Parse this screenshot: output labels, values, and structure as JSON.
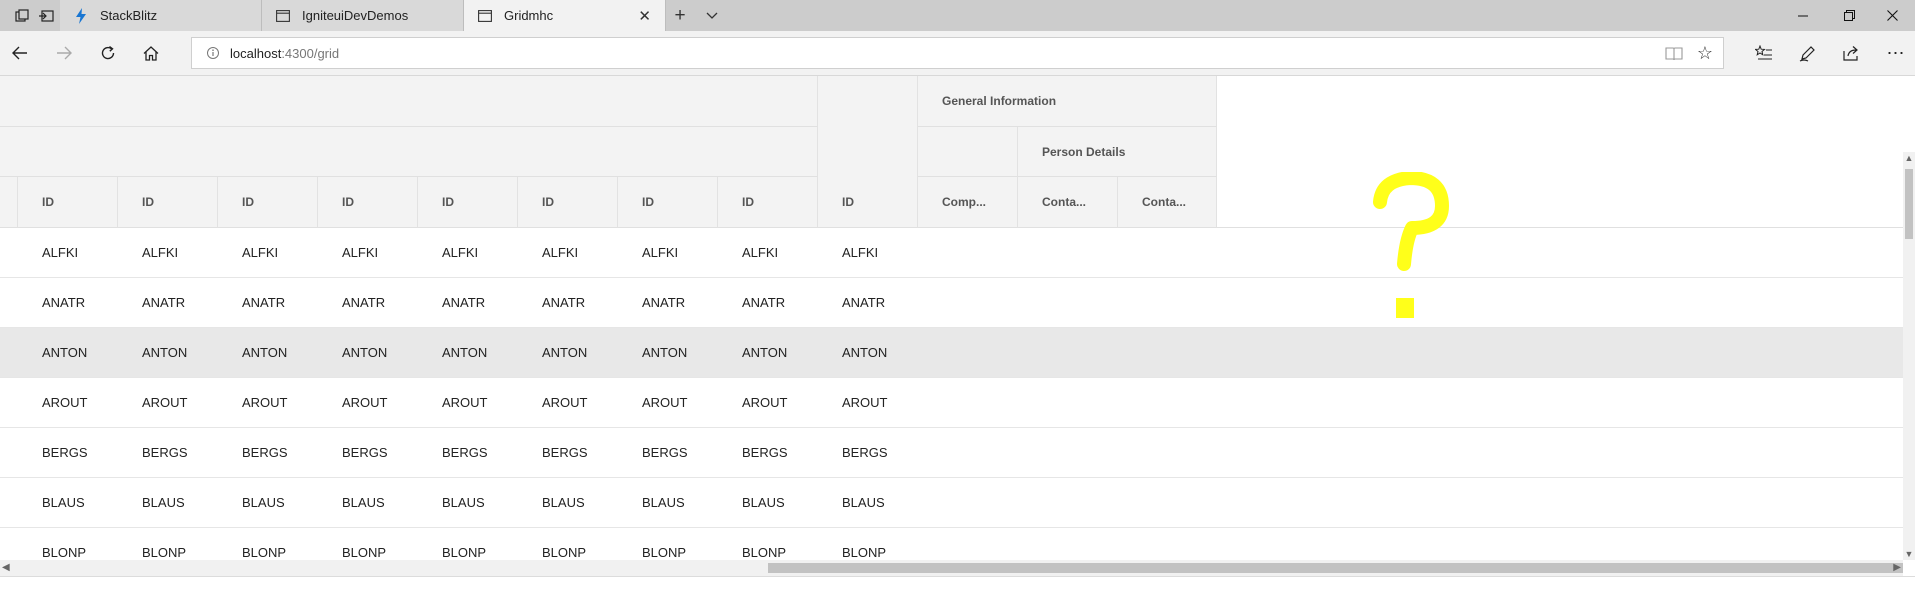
{
  "browser": {
    "tabs": [
      {
        "title": "StackBlitz",
        "icon": "lightning-icon",
        "active": false
      },
      {
        "title": "IgniteuiDevDemos",
        "icon": "page-icon",
        "active": false
      },
      {
        "title": "Gridmhc",
        "icon": "page-icon",
        "active": true
      }
    ],
    "address": {
      "host": "localhost",
      "path": ":4300/grid"
    },
    "colors": {
      "tabstrip": "#cccccc",
      "active_tab": "#f2f2f2",
      "lightning": "#1976d2"
    }
  },
  "grid": {
    "group_headers": {
      "general_information": "General Information",
      "person_details": "Person Details"
    },
    "columns": [
      "ID",
      "ID",
      "ID",
      "ID",
      "ID",
      "ID",
      "ID",
      "ID",
      "ID",
      "Comp...",
      "Conta...",
      "Conta..."
    ],
    "rows": [
      {
        "values": [
          "ALFKI",
          "ALFKI",
          "ALFKI",
          "ALFKI",
          "ALFKI",
          "ALFKI",
          "ALFKI",
          "ALFKI",
          "ALFKI"
        ],
        "selected": false
      },
      {
        "values": [
          "ANATR",
          "ANATR",
          "ANATR",
          "ANATR",
          "ANATR",
          "ANATR",
          "ANATR",
          "ANATR",
          "ANATR"
        ],
        "selected": false
      },
      {
        "values": [
          "ANTON",
          "ANTON",
          "ANTON",
          "ANTON",
          "ANTON",
          "ANTON",
          "ANTON",
          "ANTON",
          "ANTON"
        ],
        "selected": true
      },
      {
        "values": [
          "AROUT",
          "AROUT",
          "AROUT",
          "AROUT",
          "AROUT",
          "AROUT",
          "AROUT",
          "AROUT",
          "AROUT"
        ],
        "selected": false
      },
      {
        "values": [
          "BERGS",
          "BERGS",
          "BERGS",
          "BERGS",
          "BERGS",
          "BERGS",
          "BERGS",
          "BERGS",
          "BERGS"
        ],
        "selected": false
      },
      {
        "values": [
          "BLAUS",
          "BLAUS",
          "BLAUS",
          "BLAUS",
          "BLAUS",
          "BLAUS",
          "BLAUS",
          "BLAUS",
          "BLAUS"
        ],
        "selected": false
      },
      {
        "values": [
          "BLONP",
          "BLONP",
          "BLONP",
          "BLONP",
          "BLONP",
          "BLONP",
          "BLONP",
          "BLONP",
          "BLONP"
        ],
        "selected": false
      }
    ],
    "colors": {
      "header_bg": "#f3f3f3",
      "selected_row": "#e8e8e8",
      "annotation": "#ffff1a"
    }
  }
}
